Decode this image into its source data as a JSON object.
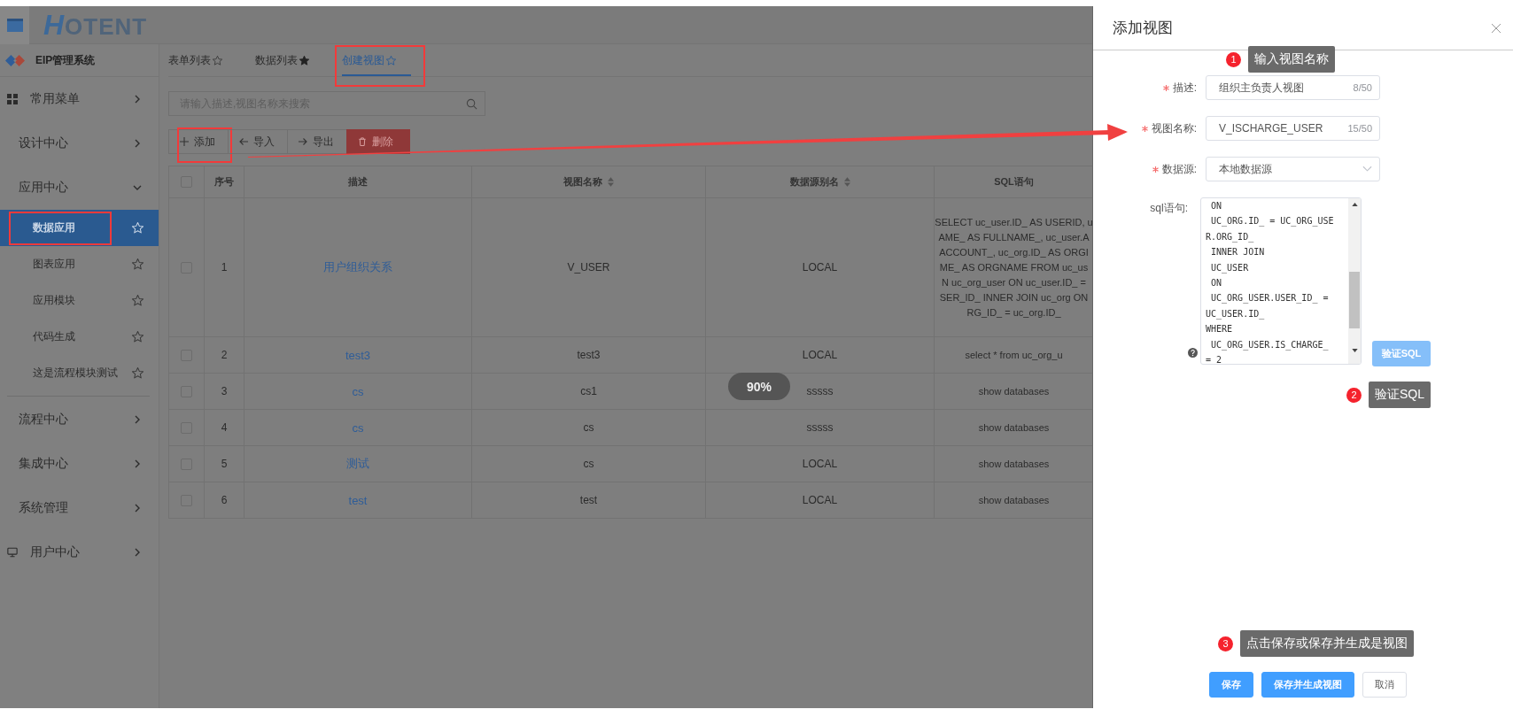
{
  "header": {
    "logo": "HOTENT"
  },
  "sidebar": {
    "system_name": "EIP管理系统",
    "items": [
      {
        "label": "常用菜单",
        "kind": "menu",
        "expanded": false
      },
      {
        "label": "设计中心",
        "kind": "group",
        "expanded": false
      },
      {
        "label": "应用中心",
        "kind": "group",
        "expanded": true,
        "children": [
          {
            "label": "数据应用",
            "selected": true,
            "highlighted": true
          },
          {
            "label": "图表应用",
            "selected": false,
            "highlighted": false
          },
          {
            "label": "应用模块",
            "selected": false,
            "highlighted": false
          },
          {
            "label": "代码生成",
            "selected": false,
            "highlighted": false
          },
          {
            "label": "这是流程模块测试",
            "selected": false,
            "highlighted": false
          }
        ]
      },
      {
        "label": "流程中心",
        "kind": "group",
        "expanded": false
      },
      {
        "label": "集成中心",
        "kind": "group",
        "expanded": false
      },
      {
        "label": "系统管理",
        "kind": "group",
        "expanded": false
      },
      {
        "label": "用户中心",
        "kind": "user",
        "expanded": false
      }
    ]
  },
  "tabs": [
    {
      "label": "表单列表",
      "starred": false,
      "selected": false,
      "highlighted": false
    },
    {
      "label": "数据列表",
      "starred": true,
      "selected": false,
      "highlighted": false
    },
    {
      "label": "创建视图",
      "starred": false,
      "selected": true,
      "highlighted": true
    }
  ],
  "search": {
    "placeholder": "请输入描述,视图名称来搜索"
  },
  "toolbar": [
    {
      "label": "添加",
      "kind": "add",
      "highlighted": true
    },
    {
      "label": "导入",
      "kind": "import",
      "highlighted": false
    },
    {
      "label": "导出",
      "kind": "export",
      "highlighted": false
    },
    {
      "label": "删除",
      "kind": "delete",
      "highlighted": false
    }
  ],
  "table": {
    "all_checked": false,
    "columns": [
      {
        "label": "序号",
        "sortable": false
      },
      {
        "label": "描述",
        "sortable": false
      },
      {
        "label": "视图名称",
        "sortable": true
      },
      {
        "label": "数据源别名",
        "sortable": true
      },
      {
        "label": "SQL语句",
        "sortable": false
      }
    ],
    "rows": [
      {
        "checked": false,
        "index": "1",
        "description": "用户组织关系",
        "view_name": "V_USER",
        "source": "LOCAL",
        "sql": [
          "SELECT uc_user.ID_ AS USERID, u",
          "AME_ AS FULLNAME_, uc_user.A",
          "ACCOUNT_, uc_org.ID_ AS ORGI",
          "ME_ AS ORGNAME FROM uc_us",
          "N uc_org_user ON uc_user.ID_ =",
          "SER_ID_ INNER JOIN uc_org ON",
          "RG_ID_ = uc_org.ID_"
        ]
      },
      {
        "checked": false,
        "index": "2",
        "description": "test3",
        "view_name": "test3",
        "source": "LOCAL",
        "sql": [
          "select * from uc_org_u"
        ]
      },
      {
        "checked": false,
        "index": "3",
        "description": "cs",
        "view_name": "cs1",
        "source": "sssss",
        "sql": [
          "show databases"
        ]
      },
      {
        "checked": false,
        "index": "4",
        "description": "cs",
        "view_name": "cs",
        "source": "sssss",
        "sql": [
          "show databases"
        ]
      },
      {
        "checked": false,
        "index": "5",
        "description": "测试",
        "view_name": "cs",
        "source": "LOCAL",
        "sql": [
          "show databases"
        ]
      },
      {
        "checked": false,
        "index": "6",
        "description": "test",
        "view_name": "test",
        "source": "LOCAL",
        "sql": [
          "show databases"
        ]
      }
    ]
  },
  "zoom_indicator": "90%",
  "drawer": {
    "title": "添加视图",
    "fields": [
      {
        "label": "描述:",
        "required": true,
        "kind": "text",
        "value": "组织主负责人视图",
        "counter": "8/50"
      },
      {
        "label": "视图名称:",
        "required": true,
        "kind": "text",
        "value": "V_ISCHARGE_USER",
        "counter": "15/50"
      },
      {
        "label": "数据源:",
        "required": true,
        "kind": "select",
        "value": "本地数据源"
      },
      {
        "label": "sql语句:",
        "required": false,
        "kind": "textarea",
        "value": " ON\n UC_ORG.ID_ = UC_ORG_USE\nR.ORG_ID_\n INNER JOIN\n UC_USER\n ON\n UC_ORG_USER.USER_ID_ =\nUC_USER.ID_\nWHERE\n UC_ORG_USER.IS_CHARGE_\n= 2",
        "action": "验证SQL"
      }
    ],
    "buttons": [
      {
        "label": "保存",
        "kind": "primary"
      },
      {
        "label": "保存并生成视图",
        "kind": "primary"
      },
      {
        "label": "取消",
        "kind": "default"
      }
    ],
    "annotations": [
      {
        "number": "1",
        "text": "输入视图名称"
      },
      {
        "number": "2",
        "text": "验证SQL"
      },
      {
        "number": "3",
        "text": "点击保存或保存并生成是视图"
      }
    ]
  }
}
